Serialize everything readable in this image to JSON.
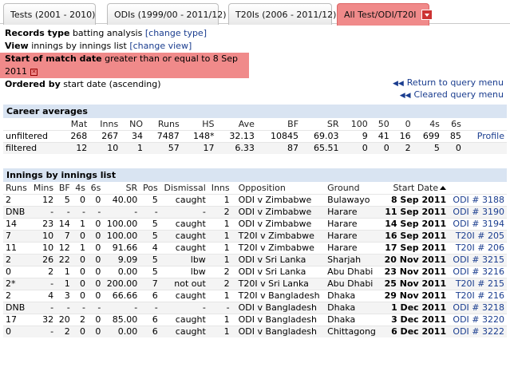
{
  "tabs": [
    {
      "label": "Tests (2001 - 2010)"
    },
    {
      "label": "ODIs (1999/00 - 2011/12)"
    },
    {
      "label": "T20Is (2006 - 2011/12)"
    },
    {
      "label": "All Test/ODI/T20I"
    }
  ],
  "query": {
    "records_type_label": "Records type",
    "records_type_value": "batting analysis",
    "change_type": "[change type]",
    "view_label": "View",
    "view_value": "innings by innings list",
    "change_view": "[change view]",
    "filter_label": "Start of match date",
    "filter_value": "greater than or equal to 8 Sep 2011",
    "ordered_label": "Ordered by",
    "ordered_value": "start date (ascending)",
    "return_link": "Return to query menu",
    "cleared_link": "Cleared query menu"
  },
  "career": {
    "title": "Career averages",
    "headers": [
      "",
      "Mat",
      "Inns",
      "NO",
      "Runs",
      "HS",
      "Ave",
      "BF",
      "SR",
      "100",
      "50",
      "0",
      "4s",
      "6s",
      ""
    ],
    "rows": [
      {
        "label": "unfiltered",
        "vals": [
          "268",
          "267",
          "34",
          "7487",
          "148*",
          "32.13",
          "10845",
          "69.03",
          "9",
          "41",
          "16",
          "699",
          "85"
        ],
        "link": "Profile"
      },
      {
        "label": "filtered",
        "vals": [
          "12",
          "10",
          "1",
          "57",
          "17",
          "6.33",
          "87",
          "65.51",
          "0",
          "0",
          "2",
          "5",
          "0"
        ],
        "link": ""
      }
    ]
  },
  "innings": {
    "title": "Innings by innings list",
    "headers": [
      "Runs",
      "Mins",
      "BF",
      "4s",
      "6s",
      "SR",
      "Pos",
      "Dismissal",
      "Inns",
      "Opposition",
      "Ground",
      "Start Date",
      ""
    ],
    "rows": [
      [
        "2",
        "12",
        "5",
        "0",
        "0",
        "40.00",
        "5",
        "caught",
        "1",
        "ODI v Zimbabwe",
        "Bulawayo",
        "8 Sep 2011",
        "ODI # 3188"
      ],
      [
        "DNB",
        "-",
        "-",
        "-",
        "-",
        "-",
        "-",
        "-",
        "2",
        "ODI v Zimbabwe",
        "Harare",
        "11 Sep 2011",
        "ODI # 3190"
      ],
      [
        "14",
        "23",
        "14",
        "1",
        "0",
        "100.00",
        "5",
        "caught",
        "1",
        "ODI v Zimbabwe",
        "Harare",
        "14 Sep 2011",
        "ODI # 3194"
      ],
      [
        "7",
        "10",
        "7",
        "0",
        "0",
        "100.00",
        "5",
        "caught",
        "1",
        "T20I v Zimbabwe",
        "Harare",
        "16 Sep 2011",
        "T20I # 205"
      ],
      [
        "11",
        "10",
        "12",
        "1",
        "0",
        "91.66",
        "4",
        "caught",
        "1",
        "T20I v Zimbabwe",
        "Harare",
        "17 Sep 2011",
        "T20I # 206"
      ],
      [
        "2",
        "26",
        "22",
        "0",
        "0",
        "9.09",
        "5",
        "lbw",
        "1",
        "ODI v Sri Lanka",
        "Sharjah",
        "20 Nov 2011",
        "ODI # 3215"
      ],
      [
        "0",
        "2",
        "1",
        "0",
        "0",
        "0.00",
        "5",
        "lbw",
        "2",
        "ODI v Sri Lanka",
        "Abu Dhabi",
        "23 Nov 2011",
        "ODI # 3216"
      ],
      [
        "2*",
        "-",
        "1",
        "0",
        "0",
        "200.00",
        "7",
        "not out",
        "2",
        "T20I v Sri Lanka",
        "Abu Dhabi",
        "25 Nov 2011",
        "T20I # 215"
      ],
      [
        "2",
        "4",
        "3",
        "0",
        "0",
        "66.66",
        "6",
        "caught",
        "1",
        "T20I v Bangladesh",
        "Dhaka",
        "29 Nov 2011",
        "T20I # 216"
      ],
      [
        "DNB",
        "-",
        "-",
        "-",
        "-",
        "-",
        "-",
        "-",
        "-",
        "ODI v Bangladesh",
        "Dhaka",
        "1 Dec 2011",
        "ODI # 3218"
      ],
      [
        "17",
        "32",
        "20",
        "2",
        "0",
        "85.00",
        "6",
        "caught",
        "1",
        "ODI v Bangladesh",
        "Dhaka",
        "3 Dec 2011",
        "ODI # 3220"
      ],
      [
        "0",
        "-",
        "2",
        "0",
        "0",
        "0.00",
        "6",
        "caught",
        "1",
        "ODI v Bangladesh",
        "Chittagong",
        "6 Dec 2011",
        "ODI # 3222"
      ]
    ]
  }
}
